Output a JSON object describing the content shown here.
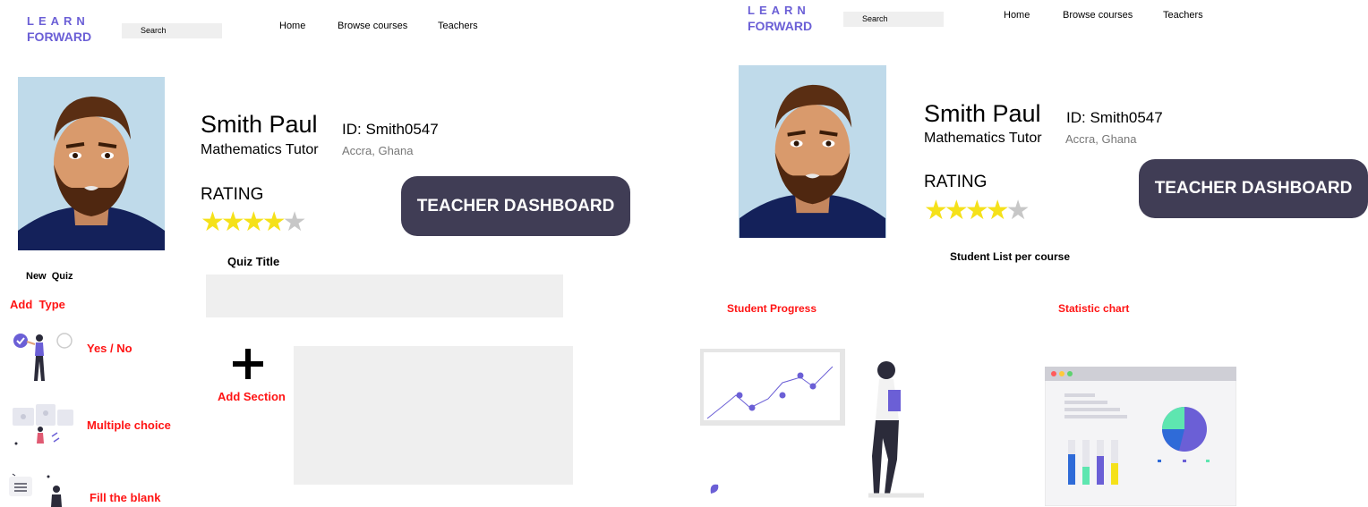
{
  "brand": {
    "line1": "LEARN",
    "line2": "FORWARD"
  },
  "search": {
    "placeholder": "Search"
  },
  "nav": {
    "home": "Home",
    "browse": "Browse courses",
    "teachers": "Teachers"
  },
  "profile": {
    "name": "Smith Paul",
    "id": "ID: Smith0547",
    "role": "Mathematics Tutor",
    "location": "Accra, Ghana",
    "rating_label": "RATING",
    "rating": 4,
    "rating_max": 5,
    "star_glyph": "★"
  },
  "dashboard_button": "TEACHER DASHBOARD",
  "quiz_panel": {
    "new_quiz": "New  Quiz",
    "add_type": "Add  Type",
    "types": [
      "Yes / No",
      "Multiple choice",
      "Fill the blank"
    ],
    "quiz_title_label": "Quiz Title",
    "add_section": "Add Section"
  },
  "dashboard_panel": {
    "student_list": "Student List per course",
    "student_progress": "Student Progress",
    "statistic_chart": "Statistic chart"
  },
  "colors": {
    "brand": "#6b5fd6",
    "button_bg": "#403d55",
    "accent_red": "#ff1414",
    "star": "#f5e11a",
    "illustration": "#6b5fd6"
  }
}
